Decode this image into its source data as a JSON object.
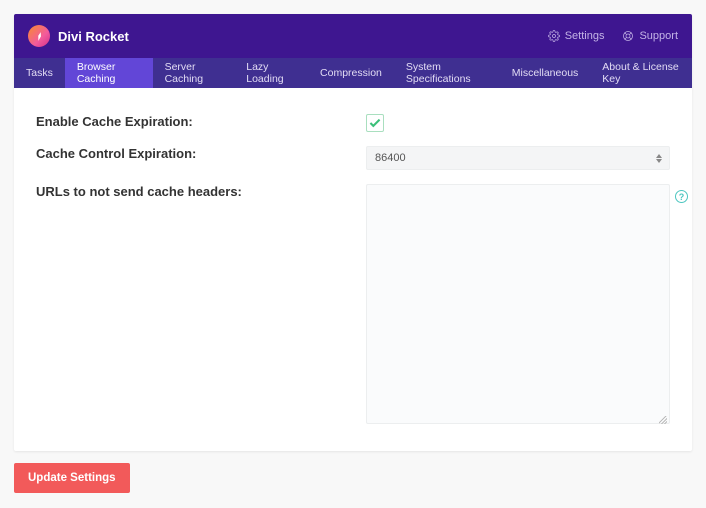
{
  "header": {
    "title": "Divi Rocket",
    "links": {
      "settings": "Settings",
      "support": "Support"
    }
  },
  "tabs": [
    {
      "label": "Tasks",
      "active": false
    },
    {
      "label": "Browser Caching",
      "active": true
    },
    {
      "label": "Server Caching",
      "active": false
    },
    {
      "label": "Lazy Loading",
      "active": false
    },
    {
      "label": "Compression",
      "active": false
    },
    {
      "label": "System Specifications",
      "active": false
    },
    {
      "label": "Miscellaneous",
      "active": false
    },
    {
      "label": "About & License Key",
      "active": false
    }
  ],
  "form": {
    "enable_cache_expiration_label": "Enable Cache Expiration:",
    "enable_cache_expiration_checked": true,
    "cache_control_expiration_label": "Cache Control Expiration:",
    "cache_control_expiration_value": "86400",
    "urls_exclude_label": "URLs to not send cache headers:",
    "urls_exclude_value": ""
  },
  "footer": {
    "update_label": "Update Settings"
  }
}
